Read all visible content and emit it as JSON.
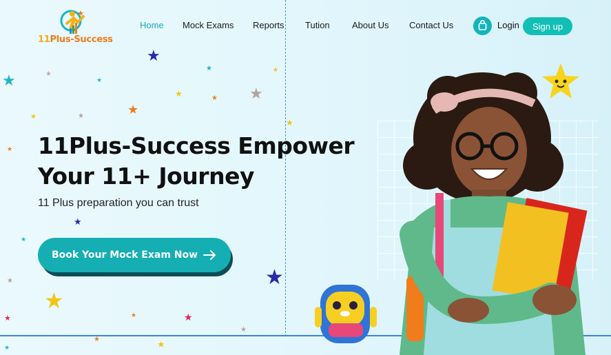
{
  "brand": {
    "logo_num": "11",
    "logo_rest": "Plus-Success"
  },
  "nav": {
    "items": [
      {
        "label": "Home",
        "active": true
      },
      {
        "label": "Mock Exams",
        "active": false
      },
      {
        "label": "Reports",
        "active": false
      },
      {
        "label": "Tution",
        "active": false
      },
      {
        "label": "About Us",
        "active": false
      },
      {
        "label": "Contact Us",
        "active": false
      }
    ],
    "login": "Login",
    "signup": "Sign up"
  },
  "hero": {
    "title_line1": "11Plus-Success Empower",
    "title_line2": "Your 11+ Journey",
    "subtitle": "11 Plus preparation you can trust",
    "cta": "Book Your Mock Exam Now"
  },
  "colors": {
    "accent": "#12b4bc",
    "nav_active": "#1aa9b7",
    "cta": "#15aeb3",
    "logo_orange": "#f07c1c"
  },
  "icons": [
    "shopping-bag-icon",
    "arrow-right-icon",
    "star-icon"
  ]
}
